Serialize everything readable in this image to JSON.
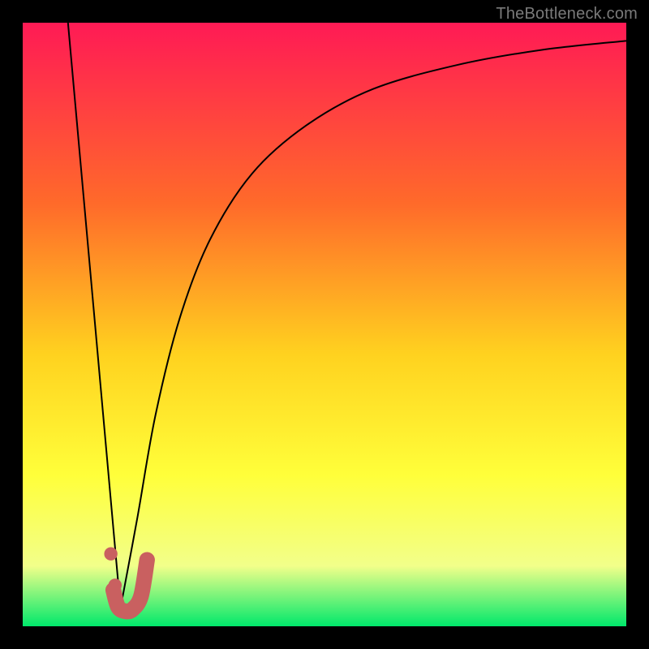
{
  "watermark": "TheBottleneck.com",
  "colors": {
    "frame": "#000000",
    "gradient_top": "#ff1a55",
    "gradient_mid1": "#ff6a2a",
    "gradient_mid2": "#ffd21f",
    "gradient_mid3": "#ffff3a",
    "gradient_mid4": "#f2ff8a",
    "gradient_bottom": "#00e86b",
    "curve": "#000000",
    "marker_fill": "#c96060",
    "marker_stroke": "#c96060"
  },
  "chart_data": {
    "type": "line",
    "title": "",
    "xlabel": "",
    "ylabel": "",
    "xlim": [
      0,
      100
    ],
    "ylim": [
      0,
      100
    ],
    "series": [
      {
        "name": "descending-branch",
        "x": [
          7.5,
          16.2
        ],
        "y": [
          100,
          3
        ]
      },
      {
        "name": "ascending-branch",
        "x": [
          16.2,
          19,
          22,
          26,
          31,
          38,
          47,
          58,
          72,
          86,
          100
        ],
        "y": [
          3,
          18,
          35,
          51,
          64,
          75,
          83,
          89,
          93,
          95.5,
          97
        ]
      }
    ],
    "markers": [
      {
        "name": "point-a",
        "x": 14.6,
        "y": 12.0,
        "r": 1.1
      },
      {
        "name": "point-b",
        "x": 15.3,
        "y": 6.8,
        "r": 1.1
      },
      {
        "name": "valley-segment",
        "kind": "thick-path",
        "path_x": [
          15.0,
          15.8,
          17.0,
          18.2,
          19.6,
          20.6
        ],
        "path_y": [
          6.0,
          3.2,
          2.5,
          2.8,
          5.0,
          11.0
        ],
        "width": 2.6
      }
    ]
  }
}
